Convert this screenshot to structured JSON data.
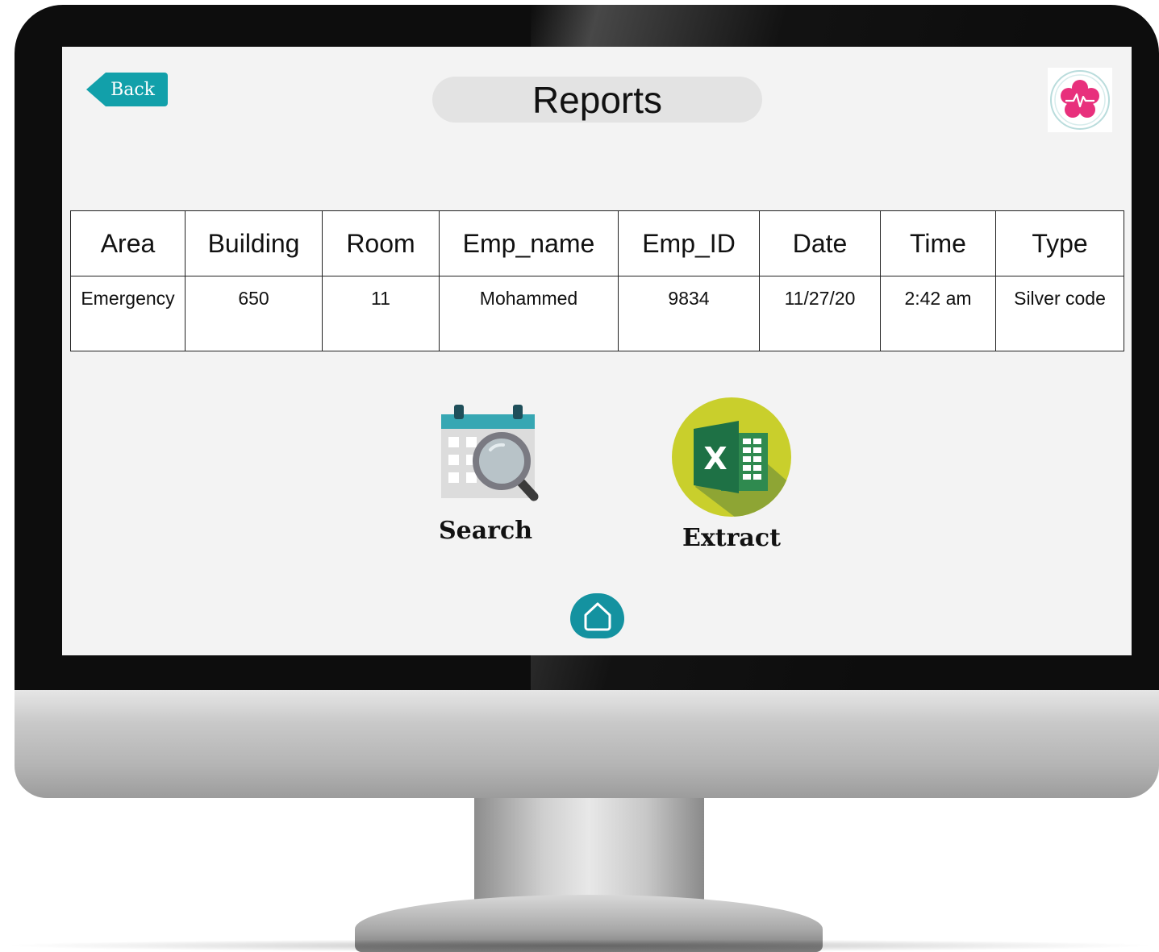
{
  "header": {
    "back_label": "Back",
    "title": "Reports"
  },
  "table": {
    "columns": [
      "Area",
      "Building",
      "Room",
      "Emp_name",
      "Emp_ID",
      "Date",
      "Time",
      "Type"
    ],
    "rows": [
      [
        "Emergency",
        "650",
        "11",
        "Mohammed",
        "9834",
        "11/27/20",
        "2:42 am",
        "Silver code"
      ]
    ]
  },
  "actions": {
    "search_label": "Search",
    "search_icon": "calendar-search-icon",
    "extract_label": "Extract",
    "extract_icon": "excel-icon"
  },
  "footer": {
    "home_icon": "home-icon"
  },
  "colors": {
    "accent": "#12a0aa",
    "logo_pink": "#e8307c",
    "excel_green": "#1e7145",
    "excel_circle": "#c9cf2c"
  }
}
